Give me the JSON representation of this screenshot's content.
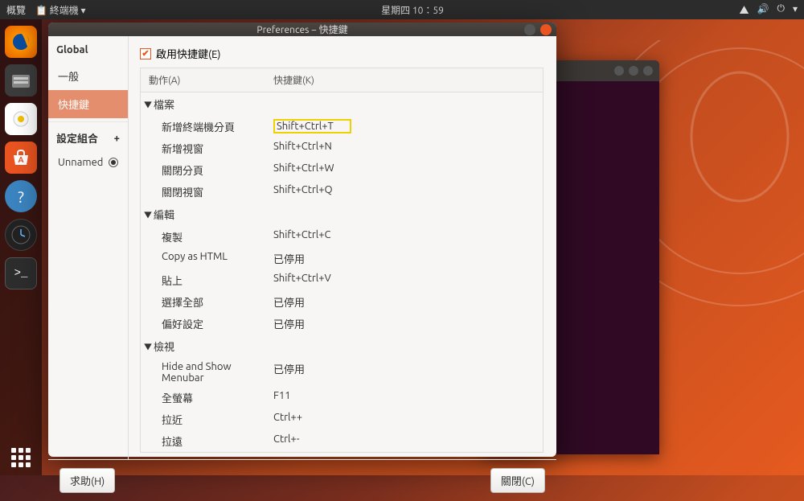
{
  "topbar": {
    "activities": "概覽",
    "appmenu": "終端機 ▾",
    "clock": "星期四 10：59",
    "icons": {
      "network": "⬚",
      "sound": "🔊",
      "power": "⏻",
      "down": "▾"
    }
  },
  "launcher": {
    "items": [
      "firefox",
      "files",
      "rhythmbox",
      "software",
      "help",
      "clock",
      "terminal"
    ]
  },
  "window": {
    "title": "Preferences − 快捷鍵"
  },
  "sidebar": {
    "global_label": "Global",
    "items": [
      {
        "label": "一般",
        "active": false
      },
      {
        "label": "快捷鍵",
        "active": true
      }
    ],
    "profiles_label": "設定組合",
    "add_label": "+",
    "profile": "Unnamed"
  },
  "content": {
    "enable_label": "啟用快捷鍵(E)",
    "enable_checked": true,
    "columns": {
      "action": "動作(A)",
      "shortcut": "快捷鍵(K)"
    },
    "groups": [
      {
        "name": "檔案",
        "items": [
          {
            "action": "新增終端機分頁",
            "shortcut": "Shift+Ctrl+T",
            "highlight": true
          },
          {
            "action": "新增視窗",
            "shortcut": "Shift+Ctrl+N"
          },
          {
            "action": "關閉分頁",
            "shortcut": "Shift+Ctrl+W"
          },
          {
            "action": "關閉視窗",
            "shortcut": "Shift+Ctrl+Q"
          }
        ]
      },
      {
        "name": "編輯",
        "items": [
          {
            "action": "複製",
            "shortcut": "Shift+Ctrl+C"
          },
          {
            "action": "Copy as HTML",
            "shortcut": "已停用"
          },
          {
            "action": "貼上",
            "shortcut": "Shift+Ctrl+V"
          },
          {
            "action": "選擇全部",
            "shortcut": "已停用"
          },
          {
            "action": "偏好設定",
            "shortcut": "已停用"
          }
        ]
      },
      {
        "name": "檢視",
        "items": [
          {
            "action": "Hide and Show Menubar",
            "shortcut": "已停用"
          },
          {
            "action": "全螢幕",
            "shortcut": "F11"
          },
          {
            "action": "拉近",
            "shortcut": "Ctrl++"
          },
          {
            "action": "拉遠",
            "shortcut": "Ctrl+-"
          }
        ]
      }
    ]
  },
  "footer": {
    "help": "求助(H)",
    "close": "關閉(C)"
  }
}
